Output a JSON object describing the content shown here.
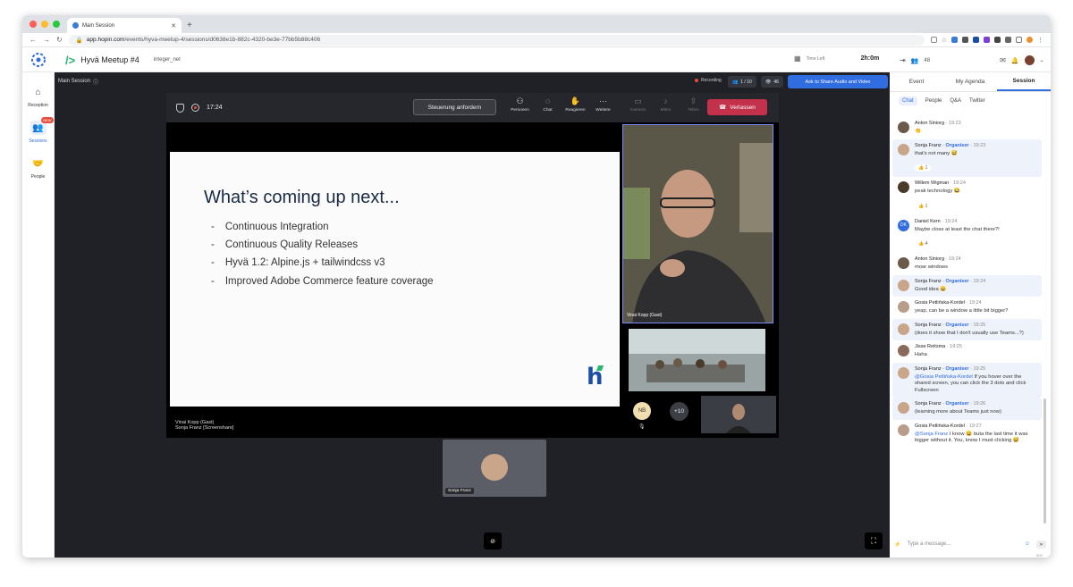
{
  "browser": {
    "tab_title": "Main Session",
    "url_host": "app.hopin.com",
    "url_path": "/events/hyva-meetup-4/sessions/d0638e1b-882c-4320-be3e-77bb5b88c406"
  },
  "header": {
    "event_title": "Hyvä Meetup #4",
    "sponsor": "integer_net",
    "time_left_label": "Time Left",
    "time_left_value": "2h:0m",
    "attendee_count": "48"
  },
  "left_nav": [
    {
      "label": "Reception",
      "icon": "home-icon"
    },
    {
      "label": "Sessions",
      "icon": "sessions-icon",
      "badge": "NEW"
    },
    {
      "label": "People",
      "icon": "handshake-icon"
    }
  ],
  "stage": {
    "session_name": "Main Session",
    "recording_label": "Recording",
    "speakers_count": "1 / 10",
    "viewers_count": "46",
    "ask_button": "Ask to Share Audio and Video",
    "teams": {
      "timer": "17:24",
      "control_button": "Steuerung anfordern",
      "icons": [
        {
          "label": "Personen",
          "icon": "people-icon",
          "dim": false
        },
        {
          "label": "Chat",
          "icon": "chat-icon",
          "dim": false
        },
        {
          "label": "Reagieren",
          "icon": "hand-icon",
          "dim": false
        },
        {
          "label": "Weitere",
          "icon": "more-icon",
          "dim": false
        },
        {
          "label": "Kamera",
          "icon": "camera-icon",
          "dim": true
        },
        {
          "label": "Mikro",
          "icon": "mic-icon",
          "dim": true
        },
        {
          "label": "Teilen",
          "icon": "share-icon",
          "dim": true
        }
      ],
      "leave_button": "Verlassen"
    },
    "slide": {
      "title": "What’s coming up next...",
      "bullets": [
        "Continuous Integration",
        "Continuous Quality Releases",
        "Hyvä 1.2: Alpine.js + tailwindcss v3",
        "Improved Adobe Commerce feature coverage"
      ],
      "logo_letter": "h"
    },
    "share_caption_1": "Vinai Kopp (Gast)",
    "share_caption_2": "Sonja Franz [Screenshare]",
    "main_video_caption": "Vinai Kopp (Gast)",
    "avatar_initials": "NB",
    "more_participants": "+10",
    "speaker_tile_name": "Sonja Franz"
  },
  "panel": {
    "tabs": [
      "Event",
      "My Agenda",
      "Session"
    ],
    "subtabs": [
      "Chat",
      "People",
      "Q&A",
      "Twitter"
    ],
    "composer_placeholder": "Type a message...",
    "char_counter": "500"
  },
  "chat": [
    {
      "name": "Anton Siniorg",
      "role": "",
      "time": "19:23",
      "text": "👏",
      "react": "",
      "org": false,
      "color": "#6b5a4a"
    },
    {
      "name": "Sonja Franz",
      "role": "Organiser",
      "time": "19:23",
      "text": "that's not many 😅",
      "react": "👍 1",
      "org": true,
      "color": "#c9a58a"
    },
    {
      "name": "Willem Wigman",
      "role": "",
      "time": "19:24",
      "text": "peak technology 😂",
      "react": "👍 1",
      "org": false,
      "color": "#4a3a2a"
    },
    {
      "name": "Daniel Kern",
      "role": "",
      "time": "19:24",
      "text": "Maybe close at least the chat there?!",
      "react": "👍 4",
      "org": false,
      "color": "#2f6de1",
      "initials": "DK"
    },
    {
      "name": "Anton Siniorg",
      "role": "",
      "time": "19:24",
      "text": "moar windows",
      "react": "",
      "org": false,
      "color": "#6b5a4a"
    },
    {
      "name": "Sonja Franz",
      "role": "Organiser",
      "time": "19:24",
      "text": "Good idea 😄",
      "react": "",
      "org": true,
      "color": "#c9a58a"
    },
    {
      "name": "Gosia Petlińska-Kordel",
      "role": "",
      "time": "19:24",
      "text": "yeap, can be a window a little bit bigger?",
      "react": "",
      "org": false,
      "color": "#b89c8c"
    },
    {
      "name": "Sonja Franz",
      "role": "Organiser",
      "time": "19:25",
      "text": "(does it show that I don't usually use Teams...?)",
      "react": "",
      "org": true,
      "color": "#c9a58a"
    },
    {
      "name": "Jisse Reitsma",
      "role": "",
      "time": "19:25",
      "text": "Haha",
      "react": "",
      "org": false,
      "color": "#8a6a5a"
    },
    {
      "name": "Sonja Franz",
      "role": "Organiser",
      "time": "19:25",
      "mention": "@Gosia Petlińska-Kordel",
      "text": " If you hover over the shared screen, you can click the 3 dots and click Fullscreen",
      "react": "",
      "org": true,
      "color": "#c9a58a"
    },
    {
      "name": "Sonja Franz",
      "role": "Organiser",
      "time": "19:26",
      "text": "(learning more about Teams just now)",
      "react": "",
      "org": true,
      "color": "#c9a58a"
    },
    {
      "name": "Gosia Petlińska-Kordel",
      "role": "",
      "time": "19:27",
      "mention": "@Sonja Franz",
      "text": " I know 😄 buta the last time it was bigger without it. You, know I must clicking 😅",
      "react": "",
      "org": false,
      "color": "#b89c8c"
    }
  ]
}
